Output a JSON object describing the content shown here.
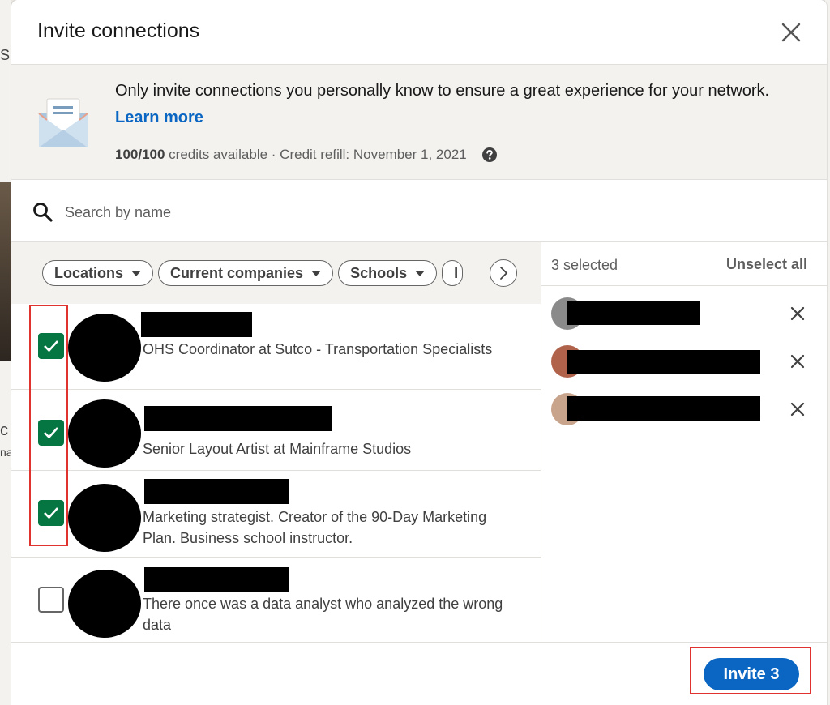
{
  "background": {
    "fragment_top": "Su",
    "fragment_mid": "c",
    "fragment_mid2": "na"
  },
  "modal": {
    "title": "Invite connections",
    "close_icon": "close-icon"
  },
  "notice": {
    "envelope_icon": "envelope-icon",
    "text": "Only invite connections you personally know to ensure a great experience for your network.",
    "learn_more": "Learn more",
    "credits_count": "100/100",
    "credits_rest": " credits available · Credit refill: November 1, 2021",
    "help_icon": "question-circle-icon"
  },
  "search": {
    "placeholder": "Search by name",
    "icon": "search-icon"
  },
  "filters": [
    {
      "label": "Locations"
    },
    {
      "label": "Current companies"
    },
    {
      "label": "Schools"
    },
    {
      "label": "I"
    }
  ],
  "people": [
    {
      "headline": "OHS Coordinator at Sutco - Transportation Specialists",
      "checked": true
    },
    {
      "headline": "Senior Layout Artist at Mainframe Studios",
      "checked": true
    },
    {
      "headline": "Marketing strategist. Creator of the 90-Day Marketing Plan. Business school instructor.",
      "checked": true
    },
    {
      "headline": "There once was a data analyst who analyzed the wrong data",
      "checked": false
    }
  ],
  "selection": {
    "count_label": "3 selected",
    "unselect_all": "Unselect all"
  },
  "footer": {
    "invite_label": "Invite 3"
  },
  "colors": {
    "accent": "#0a66c2",
    "checkbox_checked": "#057642",
    "annotation_red": "#e0322f"
  }
}
